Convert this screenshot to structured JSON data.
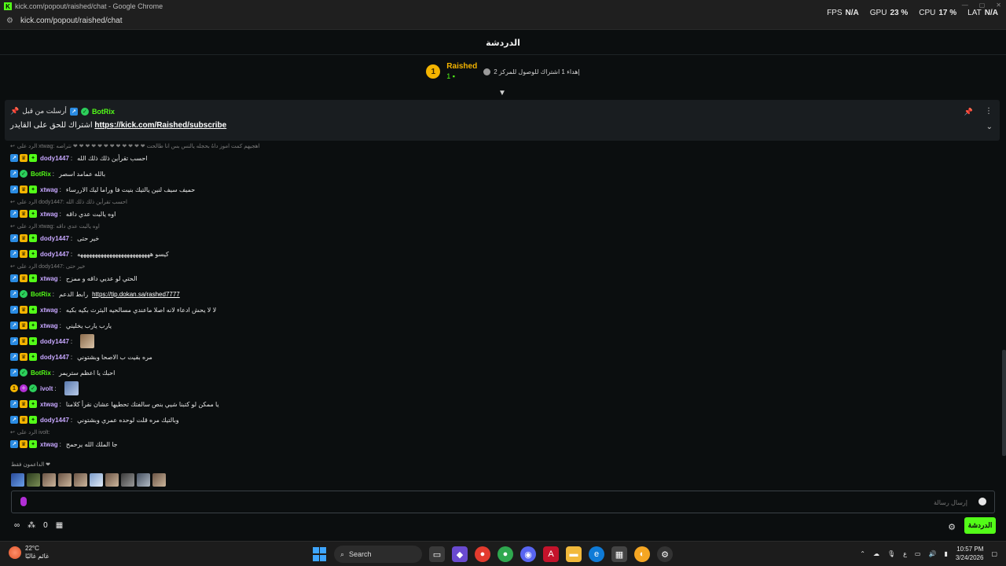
{
  "window": {
    "title": "kick.com/popout/raished/chat - Google Chrome",
    "url": "kick.com/popout/raished/chat"
  },
  "perf": {
    "fps_label": "FPS",
    "fps_value": "N/A",
    "gpu_label": "GPU",
    "gpu_value": "23 %",
    "cpu_label": "CPU",
    "cpu_value": "17 %",
    "lat_label": "LAT",
    "lat_value": "N/A"
  },
  "chat": {
    "header_title": "الدردشة",
    "leaderboard": {
      "rank": "1",
      "name": "Raished",
      "count": "1",
      "goal_text": "إهداء 1 اشتراك للوصول للمركز 2"
    },
    "pinned": {
      "sender": "BotRix",
      "sent_by": "أرسلت من قبل",
      "text": "اشتراك للحق على القايدر",
      "link": "https://kick.com/Raished/subscribe"
    },
    "messages": [
      {
        "type": "reply",
        "text": "الرد على xtwag: اهجيهم كمت اموز داهُ بحجله يالنس بس انا طالحت ❤ ❤ ❤ ❤ ❤ ❤ ❤ ❤ ❤ ❤ ❤ ❤ نتراصه"
      },
      {
        "type": "msg",
        "user": "dody1447",
        "cls": "u-dody",
        "badges": [
          "mod",
          "vip",
          "sub"
        ],
        "text": "احسب تقرأين ذلك ذلك الله"
      },
      {
        "type": "msg",
        "user": "BotRix",
        "cls": "u-bot",
        "badges": [
          "mod",
          "verif"
        ],
        "text": "بالله عمامد اسصر"
      },
      {
        "type": "msg",
        "user": "xtwag",
        "cls": "u-xtwag",
        "badges": [
          "mod",
          "vip",
          "sub"
        ],
        "text": "حميف سيف لنين يالتيك بنيت فا وراما ليك الاررساء"
      },
      {
        "type": "reply",
        "text": "الرد على dody1447: احسب تقرأين ذلك ذلك الله"
      },
      {
        "type": "msg",
        "user": "xtwag",
        "cls": "u-xtwag",
        "badges": [
          "mod",
          "vip",
          "sub"
        ],
        "text": "اوه يالبت عدي داقه"
      },
      {
        "type": "reply",
        "text": "الرد على xtwag: اوه يالبت عدي داقه"
      },
      {
        "type": "msg",
        "user": "dody1447",
        "cls": "u-dody",
        "badges": [
          "mod",
          "vip",
          "sub"
        ],
        "text": "خير حتى"
      },
      {
        "type": "msg",
        "user": "dody1447",
        "cls": "u-dody",
        "badges": [
          "mod",
          "vip",
          "sub"
        ],
        "text": "كيسو هههههههههههههههههههههههههه"
      },
      {
        "type": "reply",
        "text": "الرد على dody1447: خير حتى"
      },
      {
        "type": "msg",
        "user": "xtwag",
        "cls": "u-xtwag",
        "badges": [
          "mod",
          "vip",
          "sub"
        ],
        "text": "الحتي لو عديي داقه و ممزح"
      },
      {
        "type": "link",
        "user": "BotRix",
        "cls": "u-bot",
        "badges": [
          "mod",
          "verif"
        ],
        "text": "رابط الدعم",
        "link": "https://tip.dokan.sa/rashed7777"
      },
      {
        "type": "msg",
        "user": "xtwag",
        "cls": "u-xtwag",
        "badges": [
          "mod",
          "vip",
          "sub"
        ],
        "text": "لا لا يحش ادعاء لانه اصلا ماعندي مسالحيه البثرث بكيه بكيه"
      },
      {
        "type": "msg",
        "user": "xtwag",
        "cls": "u-xtwag",
        "badges": [
          "mod",
          "vip",
          "sub"
        ],
        "text": "يارب يارب يخليني"
      },
      {
        "type": "emote",
        "user": "dody1447",
        "cls": "u-dody",
        "badges": [
          "mod",
          "vip",
          "sub"
        ],
        "text": ""
      },
      {
        "type": "msg",
        "user": "dody1447",
        "cls": "u-dody",
        "badges": [
          "mod",
          "vip",
          "sub"
        ],
        "text": "مره بقيت ب الاصحا وبشتوني"
      },
      {
        "type": "msg",
        "user": "BotRix",
        "cls": "u-bot",
        "badges": [
          "mod",
          "verif"
        ],
        "text": "احبك يا اعظم ستريمر"
      },
      {
        "type": "emote2",
        "user": "ivolt",
        "cls": "u-ivolt",
        "badges": [
          "rank",
          "purple",
          "verif"
        ],
        "text": ""
      },
      {
        "type": "msg",
        "user": "xtwag",
        "cls": "u-xtwag",
        "badges": [
          "mod",
          "vip",
          "sub"
        ],
        "text": "يا ممكن لو كتبنا شيي بنص سالفتك تحطيها عشان نقرأ كلامنا"
      },
      {
        "type": "msg",
        "user": "dody1447",
        "cls": "u-dody",
        "badges": [
          "mod",
          "vip",
          "sub"
        ],
        "text": "وبالتيك مره قلت لوحده عمري وبشتوني"
      },
      {
        "type": "reply",
        "text": "الرد على ivolt:"
      },
      {
        "type": "msg",
        "user": "xtwag",
        "cls": "u-xtwag",
        "badges": [
          "mod",
          "vip",
          "sub"
        ],
        "text": "جا الملك الله يرحمح"
      }
    ],
    "supporters_label": "الداعمون فقط ❤",
    "input_placeholder": "إرسال رسالة",
    "footer": {
      "count": "0",
      "chat_button": "الدردشة"
    }
  },
  "taskbar": {
    "temp": "22°C",
    "weather_text": "غائم غالبًا",
    "search_label": "Search",
    "lang": "ع",
    "time": "10:57 PM",
    "date": "3/24/2026"
  }
}
